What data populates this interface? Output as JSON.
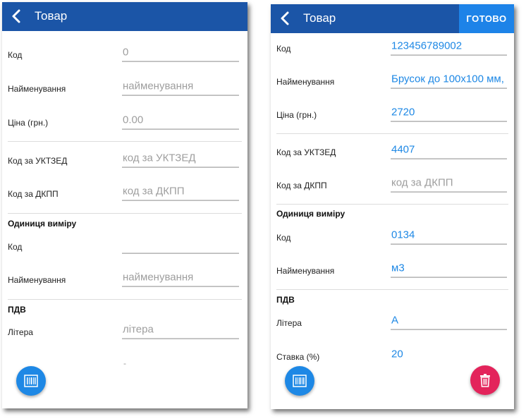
{
  "left": {
    "appbar": {
      "title": "Товар"
    },
    "fields": [
      {
        "label": "Код",
        "value": "0",
        "state": "placeholder"
      },
      {
        "label": "Найменування",
        "value": "найменування",
        "state": "placeholder"
      },
      {
        "label": "Ціна (грн.)",
        "value": "0.00",
        "state": "placeholder"
      },
      {
        "label": "Код за УКТЗЕД",
        "value": "код за УКТЗЕД",
        "state": "placeholder"
      },
      {
        "label": "Код за ДКПП",
        "value": "код за ДКПП",
        "state": "placeholder"
      }
    ],
    "unit_section": {
      "title": "Одиниця виміру",
      "fields": [
        {
          "label": "Код",
          "value": "",
          "state": "placeholder"
        },
        {
          "label": "Найменування",
          "value": "найменування",
          "state": "placeholder"
        }
      ]
    },
    "vat_section": {
      "title": "ПДВ",
      "fields": [
        {
          "label": "Літера",
          "value": "літера",
          "state": "placeholder"
        }
      ],
      "partial": "-"
    }
  },
  "right": {
    "appbar": {
      "title": "Товар",
      "done_label": "ГОТОВО"
    },
    "fields": [
      {
        "label": "Код",
        "value": "123456789002",
        "state": "filled"
      },
      {
        "label": "Найменування",
        "value": "Брусок до 100х100 мм,",
        "state": "filled"
      },
      {
        "label": "Ціна (грн.)",
        "value": "2720",
        "state": "filled"
      },
      {
        "label": "Код за УКТЗЕД",
        "value": "4407",
        "state": "filled"
      },
      {
        "label": "Код за ДКПП",
        "value": "код за ДКПП",
        "state": "placeholder"
      }
    ],
    "unit_section": {
      "title": "Одиниця виміру",
      "fields": [
        {
          "label": "Код",
          "value": "0134",
          "state": "filled"
        },
        {
          "label": "Найменування",
          "value": "м3",
          "state": "filled"
        }
      ]
    },
    "vat_section": {
      "title": "ПДВ",
      "fields": [
        {
          "label": "Літера",
          "value": "А",
          "state": "filled"
        },
        {
          "label": "Ставка (%)",
          "value": "20",
          "state": "static"
        }
      ]
    }
  },
  "colors": {
    "appbar": "#1b55a7",
    "done_button": "#1d83e8",
    "accent": "#1e88e5",
    "placeholder": "#9e9e9e",
    "delete": "#e3245b"
  },
  "icons": {
    "back": "chevron-left-icon",
    "barcode": "barcode-icon",
    "delete": "trash-icon"
  }
}
